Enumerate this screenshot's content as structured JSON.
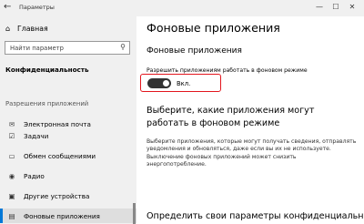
{
  "window": {
    "title": "Параметры",
    "back_icon": "←",
    "controls": [
      "—",
      "☐",
      "✕"
    ]
  },
  "sidebar": {
    "home": {
      "icon": "home-icon",
      "label": "Главная"
    },
    "search": {
      "placeholder": "Найти параметр"
    },
    "category": "Конфиденциальность",
    "section": "Разрешения приложений",
    "items": [
      {
        "icon": "mail-icon",
        "label": "Электронная почта"
      },
      {
        "icon": "tasks-icon",
        "label": "Задачи"
      },
      {
        "icon": "messaging-icon",
        "label": "Обмен сообщениями"
      },
      {
        "icon": "radio-icon",
        "label": "Радио"
      },
      {
        "icon": "devices-icon",
        "label": "Другие устройства"
      },
      {
        "icon": "background-apps-icon",
        "label": "Фоновые приложения"
      }
    ],
    "selected_index": 5
  },
  "main": {
    "page_title": "Фоновые приложения",
    "section_title": "Фоновые приложения",
    "toggle_label": "Разрешить приложениям работать в фоновом режиме",
    "toggle_state": "Вкл.",
    "toggle_on": true,
    "choose_heading": "Выберите, какие приложения могут работать в фоновом режиме",
    "choose_desc": "Выберите приложения, которые могут получать сведения, отправлять уведомления и обновляться, даже если вы их не используете. Выключение фоновых приложений может снизить энергопотребление.",
    "privacy_heading": "Определить свои параметры конфиденциальности"
  },
  "colors": {
    "accent": "#0078d7",
    "highlight": "#e3151d",
    "sidebar_bg": "#f0f0f0"
  }
}
